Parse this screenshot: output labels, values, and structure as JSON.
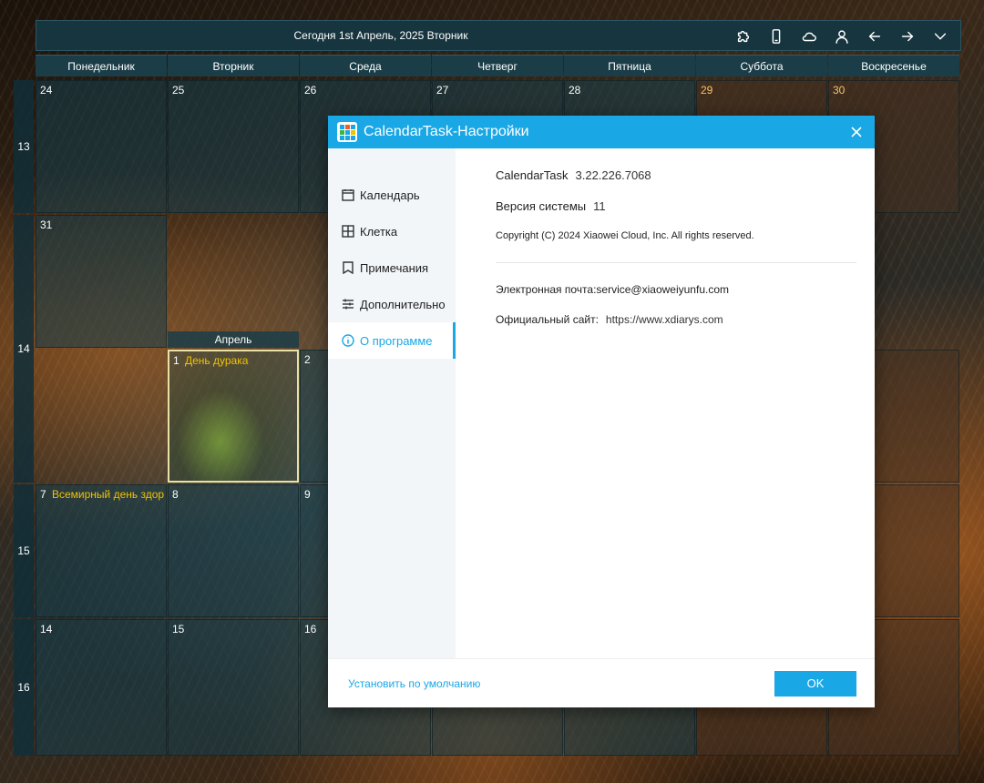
{
  "header": {
    "title": "Сегодня 1st Апрель, 2025 Вторник",
    "tools": [
      "puzzle-icon",
      "phone-icon",
      "cloud-icon",
      "user-icon",
      "arrow-left-icon",
      "arrow-right-icon",
      "chevron-down-icon"
    ]
  },
  "days": [
    "Понедельник",
    "Вторник",
    "Среда",
    "Четверг",
    "Пятница",
    "Суббота",
    "Воскресенье"
  ],
  "weeks": [
    "13",
    "14",
    "15",
    "16"
  ],
  "month_label": "Апрель",
  "cells": {
    "w13": [
      "24",
      "25",
      "26",
      "27",
      "28",
      "29",
      "30"
    ],
    "w14": [
      "31",
      "1",
      "2"
    ],
    "w15": [
      "7",
      "8",
      "9"
    ],
    "w16": [
      "14",
      "15",
      "16"
    ]
  },
  "events": {
    "apr1": "День дурака",
    "apr7": "Всемирный день здор"
  },
  "dialog": {
    "title": "CalendarTask-Настройки",
    "nav": [
      {
        "label": "Календарь",
        "icon": "calendar-icon"
      },
      {
        "label": "Клетка",
        "icon": "grid-icon"
      },
      {
        "label": "Примечания",
        "icon": "bookmark-icon"
      },
      {
        "label": "Дополнительно",
        "icon": "sliders-icon"
      },
      {
        "label": "О программе",
        "icon": "info-icon"
      }
    ],
    "about": {
      "app_name": "CalendarTask",
      "app_version": "3.22.226.7068",
      "system_label": "Версия системы",
      "system_version": "11",
      "copyright": "Copyright (C) 2024 Xiaowei Cloud, Inc. All rights reserved.",
      "email": "Электронная почта:service@xiaoweiyunfu.com",
      "site_label": "Официальный сайт:",
      "site_url": "https://www.xdiarys.com"
    },
    "reset_label": "Установить по умолчанию",
    "ok_label": "OK"
  },
  "colors": {
    "accent": "#1aa7e6",
    "event": "#f2c200",
    "weekend_number": "#f6c56a",
    "header_bg": "#17353f"
  }
}
